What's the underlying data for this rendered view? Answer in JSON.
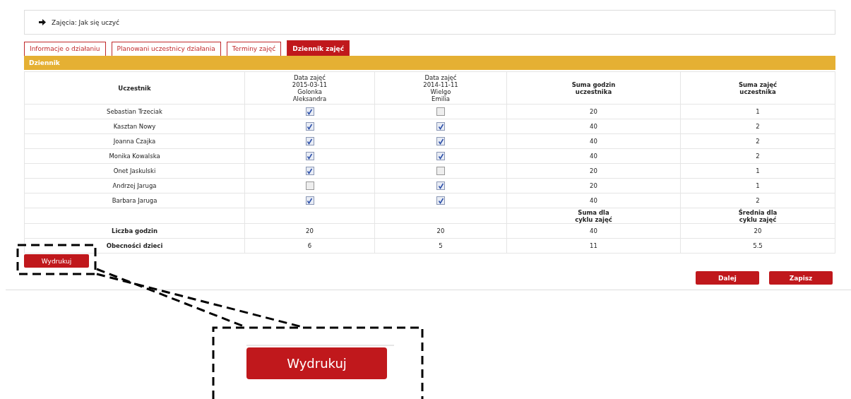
{
  "breadcrumb": {
    "text": "Zajęcia: Jak się uczyć"
  },
  "tabs": [
    {
      "label": "Informacje o działaniu",
      "selected": false
    },
    {
      "label": "Planowani uczestnicy działania",
      "selected": false
    },
    {
      "label": "Terminy zajęć",
      "selected": false
    },
    {
      "label": "Dziennik zajęć",
      "selected": true
    }
  ],
  "panel": {
    "title": "Dziennik"
  },
  "table": {
    "columns": [
      {
        "lines": [
          "Uczestnik"
        ],
        "bold": true
      },
      {
        "lines": [
          "Data zajęć",
          "2015-03-11",
          "Golonka",
          "Aleksandra"
        ],
        "bold": false
      },
      {
        "lines": [
          "Data zajęć",
          "2014-11-11",
          "Wielgo",
          "Emilia"
        ],
        "bold": false
      },
      {
        "lines": [
          "Suma godzin",
          "uczestnika"
        ],
        "bold": true
      },
      {
        "lines": [
          "Suma zajęć",
          "uczestnika"
        ],
        "bold": true
      }
    ],
    "rows": [
      {
        "name": "Sebastian Trzeciak",
        "attendance": [
          {
            "checked": true
          },
          {
            "checked": false
          }
        ],
        "hours": "20",
        "count": "1"
      },
      {
        "name": "Kasztan Nowy",
        "attendance": [
          {
            "checked": true
          },
          {
            "checked": true
          }
        ],
        "hours": "40",
        "count": "2"
      },
      {
        "name": "Joanna Czajka",
        "attendance": [
          {
            "checked": true
          },
          {
            "checked": true
          }
        ],
        "hours": "40",
        "count": "2"
      },
      {
        "name": "Monika Kowalska",
        "attendance": [
          {
            "checked": true
          },
          {
            "checked": true
          }
        ],
        "hours": "40",
        "count": "2"
      },
      {
        "name": "Onet Jaskulski",
        "attendance": [
          {
            "checked": true
          },
          {
            "checked": false
          }
        ],
        "hours": "20",
        "count": "1"
      },
      {
        "name": "Andrzej Jaruga",
        "attendance": [
          {
            "checked": false
          },
          {
            "checked": true
          }
        ],
        "hours": "20",
        "count": "1"
      },
      {
        "name": "Barbara Jaruga",
        "attendance": [
          {
            "checked": true
          },
          {
            "checked": true
          }
        ],
        "hours": "40",
        "count": "2"
      }
    ],
    "summary_labels": [
      {
        "lines": [
          "Suma dla",
          "cyklu zajęć"
        ]
      },
      {
        "lines": [
          "Średnia dla",
          "cyklu zajęć"
        ]
      }
    ],
    "totals": [
      {
        "label": "Liczba godzin",
        "values": [
          "20",
          "20",
          "40",
          "20"
        ]
      },
      {
        "label": "Obecności dzieci",
        "values": [
          "6",
          "5",
          "11",
          "5.5"
        ]
      }
    ]
  },
  "buttons": {
    "print": "Wydrukuj",
    "next": "Dalej",
    "save": "Zapisz"
  },
  "callout": {
    "button": "Wydrukuj"
  }
}
